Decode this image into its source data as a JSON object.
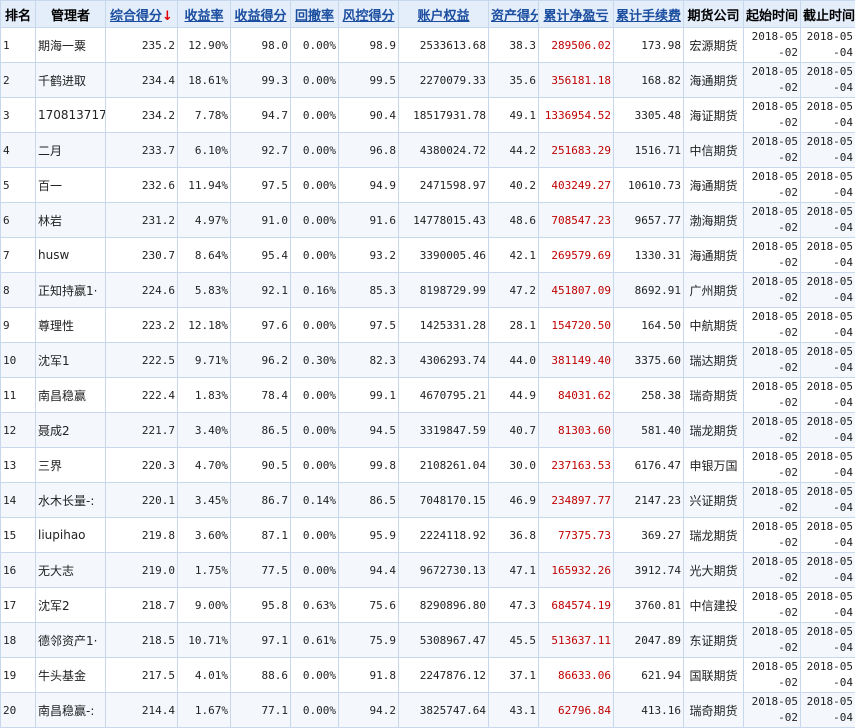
{
  "table": {
    "columns": [
      "排名",
      "管理者",
      "综合得分",
      "收益率",
      "收益得分",
      "回撤率",
      "风控得分",
      "账户权益",
      "资产得分",
      "累计净盈亏",
      "累计手续费",
      "期货公司",
      "起始时间",
      "截止时间"
    ],
    "sort_indicator": "↓",
    "rows": [
      {
        "rank": "1",
        "manager": "期海一粟",
        "score": "235.2",
        "return": "12.90%",
        "return_score": "98.0",
        "drawdown": "0.00%",
        "risk_score": "98.9",
        "equity": "2533613.68",
        "asset_score": "38.3",
        "net_profit": "289506.02",
        "fee": "173.98",
        "company": "宏源期货",
        "start": "2018-05-02",
        "end": "2018-05-04"
      },
      {
        "rank": "2",
        "manager": "千鹤进取",
        "score": "234.4",
        "return": "18.61%",
        "return_score": "99.3",
        "drawdown": "0.00%",
        "risk_score": "99.5",
        "equity": "2270079.33",
        "asset_score": "35.6",
        "net_profit": "356181.18",
        "fee": "168.82",
        "company": "海通期货",
        "start": "2018-05-02",
        "end": "2018-05-04"
      },
      {
        "rank": "3",
        "manager": "170813717:",
        "score": "234.2",
        "return": "7.78%",
        "return_score": "94.7",
        "drawdown": "0.00%",
        "risk_score": "90.4",
        "equity": "18517931.78",
        "asset_score": "49.1",
        "net_profit": "1336954.52",
        "fee": "3305.48",
        "company": "海证期货",
        "start": "2018-05-02",
        "end": "2018-05-04"
      },
      {
        "rank": "4",
        "manager": "二月",
        "score": "233.7",
        "return": "6.10%",
        "return_score": "92.7",
        "drawdown": "0.00%",
        "risk_score": "96.8",
        "equity": "4380024.72",
        "asset_score": "44.2",
        "net_profit": "251683.29",
        "fee": "1516.71",
        "company": "中信期货",
        "start": "2018-05-02",
        "end": "2018-05-04"
      },
      {
        "rank": "5",
        "manager": "百一",
        "score": "232.6",
        "return": "11.94%",
        "return_score": "97.5",
        "drawdown": "0.00%",
        "risk_score": "94.9",
        "equity": "2471598.97",
        "asset_score": "40.2",
        "net_profit": "403249.27",
        "fee": "10610.73",
        "company": "海通期货",
        "start": "2018-05-02",
        "end": "2018-05-04"
      },
      {
        "rank": "6",
        "manager": "林岩",
        "score": "231.2",
        "return": "4.97%",
        "return_score": "91.0",
        "drawdown": "0.00%",
        "risk_score": "91.6",
        "equity": "14778015.43",
        "asset_score": "48.6",
        "net_profit": "708547.23",
        "fee": "9657.77",
        "company": "渤海期货",
        "start": "2018-05-02",
        "end": "2018-05-04"
      },
      {
        "rank": "7",
        "manager": "husw",
        "score": "230.7",
        "return": "8.64%",
        "return_score": "95.4",
        "drawdown": "0.00%",
        "risk_score": "93.2",
        "equity": "3390005.46",
        "asset_score": "42.1",
        "net_profit": "269579.69",
        "fee": "1330.31",
        "company": "海通期货",
        "start": "2018-05-02",
        "end": "2018-05-04"
      },
      {
        "rank": "8",
        "manager": "正知持嬴1·",
        "score": "224.6",
        "return": "5.83%",
        "return_score": "92.1",
        "drawdown": "0.16%",
        "risk_score": "85.3",
        "equity": "8198729.99",
        "asset_score": "47.2",
        "net_profit": "451807.09",
        "fee": "8692.91",
        "company": "广州期货",
        "start": "2018-05-02",
        "end": "2018-05-04"
      },
      {
        "rank": "9",
        "manager": "尊理性",
        "score": "223.2",
        "return": "12.18%",
        "return_score": "97.6",
        "drawdown": "0.00%",
        "risk_score": "97.5",
        "equity": "1425331.28",
        "asset_score": "28.1",
        "net_profit": "154720.50",
        "fee": "164.50",
        "company": "中航期货",
        "start": "2018-05-02",
        "end": "2018-05-04"
      },
      {
        "rank": "10",
        "manager": "沈军1",
        "score": "222.5",
        "return": "9.71%",
        "return_score": "96.2",
        "drawdown": "0.30%",
        "risk_score": "82.3",
        "equity": "4306293.74",
        "asset_score": "44.0",
        "net_profit": "381149.40",
        "fee": "3375.60",
        "company": "瑞达期货",
        "start": "2018-05-02",
        "end": "2018-05-04"
      },
      {
        "rank": "11",
        "manager": "南昌稳赢",
        "score": "222.4",
        "return": "1.83%",
        "return_score": "78.4",
        "drawdown": "0.00%",
        "risk_score": "99.1",
        "equity": "4670795.21",
        "asset_score": "44.9",
        "net_profit": "84031.62",
        "fee": "258.38",
        "company": "瑞奇期货",
        "start": "2018-05-02",
        "end": "2018-05-04"
      },
      {
        "rank": "12",
        "manager": "聂成2",
        "score": "221.7",
        "return": "3.40%",
        "return_score": "86.5",
        "drawdown": "0.00%",
        "risk_score": "94.5",
        "equity": "3319847.59",
        "asset_score": "40.7",
        "net_profit": "81303.60",
        "fee": "581.40",
        "company": "瑞龙期货",
        "start": "2018-05-02",
        "end": "2018-05-04"
      },
      {
        "rank": "13",
        "manager": "三界",
        "score": "220.3",
        "return": "4.70%",
        "return_score": "90.5",
        "drawdown": "0.00%",
        "risk_score": "99.8",
        "equity": "2108261.04",
        "asset_score": "30.0",
        "net_profit": "237163.53",
        "fee": "6176.47",
        "company": "申银万国",
        "start": "2018-05-02",
        "end": "2018-05-04"
      },
      {
        "rank": "14",
        "manager": "水木长量-:",
        "score": "220.1",
        "return": "3.45%",
        "return_score": "86.7",
        "drawdown": "0.14%",
        "risk_score": "86.5",
        "equity": "7048170.15",
        "asset_score": "46.9",
        "net_profit": "234897.77",
        "fee": "2147.23",
        "company": "兴证期货",
        "start": "2018-05-02",
        "end": "2018-05-04"
      },
      {
        "rank": "15",
        "manager": "liupihao",
        "score": "219.8",
        "return": "3.60%",
        "return_score": "87.1",
        "drawdown": "0.00%",
        "risk_score": "95.9",
        "equity": "2224118.92",
        "asset_score": "36.8",
        "net_profit": "77375.73",
        "fee": "369.27",
        "company": "瑞龙期货",
        "start": "2018-05-02",
        "end": "2018-05-04"
      },
      {
        "rank": "16",
        "manager": "无大志",
        "score": "219.0",
        "return": "1.75%",
        "return_score": "77.5",
        "drawdown": "0.00%",
        "risk_score": "94.4",
        "equity": "9672730.13",
        "asset_score": "47.1",
        "net_profit": "165932.26",
        "fee": "3912.74",
        "company": "光大期货",
        "start": "2018-05-02",
        "end": "2018-05-04"
      },
      {
        "rank": "17",
        "manager": "沈军2",
        "score": "218.7",
        "return": "9.00%",
        "return_score": "95.8",
        "drawdown": "0.63%",
        "risk_score": "75.6",
        "equity": "8290896.80",
        "asset_score": "47.3",
        "net_profit": "684574.19",
        "fee": "3760.81",
        "company": "中信建投",
        "start": "2018-05-02",
        "end": "2018-05-04"
      },
      {
        "rank": "18",
        "manager": "德邻资产1·",
        "score": "218.5",
        "return": "10.71%",
        "return_score": "97.1",
        "drawdown": "0.61%",
        "risk_score": "75.9",
        "equity": "5308967.47",
        "asset_score": "45.5",
        "net_profit": "513637.11",
        "fee": "2047.89",
        "company": "东证期货",
        "start": "2018-05-02",
        "end": "2018-05-04"
      },
      {
        "rank": "19",
        "manager": "牛头基金",
        "score": "217.5",
        "return": "4.01%",
        "return_score": "88.6",
        "drawdown": "0.00%",
        "risk_score": "91.8",
        "equity": "2247876.12",
        "asset_score": "37.1",
        "net_profit": "86633.06",
        "fee": "621.94",
        "company": "国联期货",
        "start": "2018-05-02",
        "end": "2018-05-04"
      },
      {
        "rank": "20",
        "manager": "南昌稳赢-:",
        "score": "214.4",
        "return": "1.67%",
        "return_score": "77.1",
        "drawdown": "0.00%",
        "risk_score": "94.2",
        "equity": "3825747.64",
        "asset_score": "43.1",
        "net_profit": "62796.84",
        "fee": "413.16",
        "company": "瑞奇期货",
        "start": "2018-05-02",
        "end": "2018-05-04"
      }
    ]
  },
  "colors": {
    "header_bg": "#e4eefa",
    "sortable_link": "#1c4ea0",
    "profit_text": "#c00000",
    "border": "#c7d8ec"
  }
}
